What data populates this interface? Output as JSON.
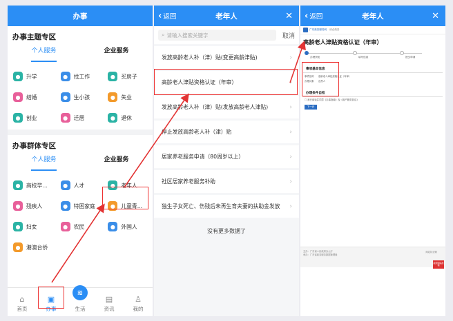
{
  "colors": {
    "primary": "#2b8ef5",
    "highlight": "#e33333"
  },
  "screen1": {
    "title": "办事",
    "section1_title": "办事主题专区",
    "section1_tabs": [
      "个人服务",
      "企业服务"
    ],
    "section1_items": [
      {
        "label": "升学",
        "icon": "graduation-icon",
        "color": "#2bb3a5"
      },
      {
        "label": "找工作",
        "icon": "briefcase-icon",
        "color": "#3b8ee8"
      },
      {
        "label": "买房子",
        "icon": "house-icon",
        "color": "#2bb3a5"
      },
      {
        "label": "结婚",
        "icon": "heart-icon",
        "color": "#e8609a"
      },
      {
        "label": "生小孩",
        "icon": "baby-icon",
        "color": "#3b8ee8"
      },
      {
        "label": "失业",
        "icon": "jobless-icon",
        "color": "#f39a2b"
      },
      {
        "label": "创业",
        "icon": "balloon-icon",
        "color": "#2bb3a5"
      },
      {
        "label": "迁居",
        "icon": "truck-icon",
        "color": "#e8609a"
      },
      {
        "label": "退休",
        "icon": "elder-icon",
        "color": "#2bb3a5"
      }
    ],
    "section2_title": "办事群体专区",
    "section2_tabs": [
      "个人服务",
      "企业服务"
    ],
    "section2_items": [
      {
        "label": "高校毕...",
        "icon": "grad-cap-icon",
        "color": "#2bb3a5"
      },
      {
        "label": "人才",
        "icon": "person-icon",
        "color": "#3b8ee8"
      },
      {
        "label": "老年人",
        "icon": "elder-icon",
        "color": "#2bb3a5"
      },
      {
        "label": "残疾人",
        "icon": "wheelchair-icon",
        "color": "#e8609a"
      },
      {
        "label": "特困家庭",
        "icon": "family-icon",
        "color": "#3b8ee8"
      },
      {
        "label": "儿童青...",
        "icon": "child-icon",
        "color": "#f39a2b"
      },
      {
        "label": "妇女",
        "icon": "woman-icon",
        "color": "#2bb3a5"
      },
      {
        "label": "农民",
        "icon": "farmer-icon",
        "color": "#e8609a"
      },
      {
        "label": "外国人",
        "icon": "passport-icon",
        "color": "#3b8ee8"
      },
      {
        "label": "港澳台侨",
        "icon": "globe-icon",
        "color": "#f39a2b"
      }
    ],
    "nav": [
      {
        "label": "首页",
        "icon": "home-icon",
        "glyph": "⌂"
      },
      {
        "label": "办事",
        "icon": "briefcase-icon",
        "glyph": "▣"
      },
      {
        "label": "生活",
        "icon": "life-icon",
        "glyph": "≋"
      },
      {
        "label": "资讯",
        "icon": "news-icon",
        "glyph": "▤"
      },
      {
        "label": "我的",
        "icon": "user-icon",
        "glyph": "♙"
      }
    ]
  },
  "screen2": {
    "back_label": "返回",
    "title": "老年人",
    "close_glyph": "✕",
    "search_placeholder": "请输入搜索关键字",
    "cancel_label": "取消",
    "items": [
      "发放高龄老人补（津）贴(变更高龄津贴)",
      "高龄老人津贴资格认证（年审）",
      "发放高龄老人补（津）贴(发放高龄老人津贴)",
      "停止发放高龄老人补（津）贴",
      "居家养老服务申请（80周岁以上）",
      "社区居家养老服务补助",
      "独生子女死亡、伤残后未再生育夫妻的扶助金发放"
    ],
    "no_more": "没有更多数据了"
  },
  "screen3": {
    "back_label": "返回",
    "title": "老年人",
    "close_glyph": "✕",
    "org_name": "广东政务服务网",
    "org_sub": "综合政务",
    "doc_title": "高龄老人津贴资格认证（年审）",
    "steps": [
      "办理须知",
      "填写信息",
      "提交申请"
    ],
    "section_basic": "事项基本信息",
    "basic_rows": [
      {
        "k": "事项名称",
        "v": "高龄老人津贴资格认证（年审）"
      },
      {
        "k": "办理对象",
        "v": "自然人"
      }
    ],
    "section_check": "办理条件自检",
    "agree_text": "我已阅读并同意《办事指南》及《用户服务协议》",
    "next_label": "下一步",
    "footer_lines": [
      "主办：广东省人民政府办公厅",
      "承办：广东省政务服务数据管理局"
    ],
    "footer_right": "网站标识码",
    "badge_text": "政府网站找错"
  }
}
